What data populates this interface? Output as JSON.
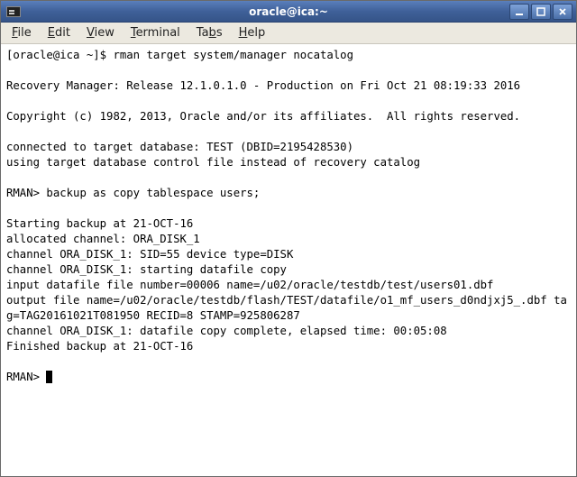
{
  "window": {
    "title": "oracle@ica:~"
  },
  "menus": {
    "file": "File",
    "edit": "Edit",
    "view": "View",
    "terminal": "Terminal",
    "tabs": "Tabs",
    "help": "Help"
  },
  "terminal": {
    "prompt1": "[oracle@ica ~]$ ",
    "cmd1": "rman target system/manager nocatalog",
    "blank": "",
    "line_release": "Recovery Manager: Release 12.1.0.1.0 - Production on Fri Oct 21 08:19:33 2016",
    "line_copyright": "Copyright (c) 1982, 2013, Oracle and/or its affiliates.  All rights reserved.",
    "line_connected": "connected to target database: TEST (DBID=2195428530)",
    "line_controlfile": "using target database control file instead of recovery catalog",
    "prompt2": "RMAN> ",
    "cmd2": "backup as copy tablespace users;",
    "line_start": "Starting backup at 21-OCT-16",
    "line_alloc": "allocated channel: ORA_DISK_1",
    "line_sid": "channel ORA_DISK_1: SID=55 device type=DISK",
    "line_starting": "channel ORA_DISK_1: starting datafile copy",
    "line_input": "input datafile file number=00006 name=/u02/oracle/testdb/test/users01.dbf",
    "line_output": "output file name=/u02/oracle/testdb/flash/TEST/datafile/o1_mf_users_d0ndjxj5_.dbf tag=TAG20161021T081950 RECID=8 STAMP=925806287",
    "line_complete": "channel ORA_DISK_1: datafile copy complete, elapsed time: 00:05:08",
    "line_finished": "Finished backup at 21-OCT-16",
    "prompt3": "RMAN> "
  }
}
